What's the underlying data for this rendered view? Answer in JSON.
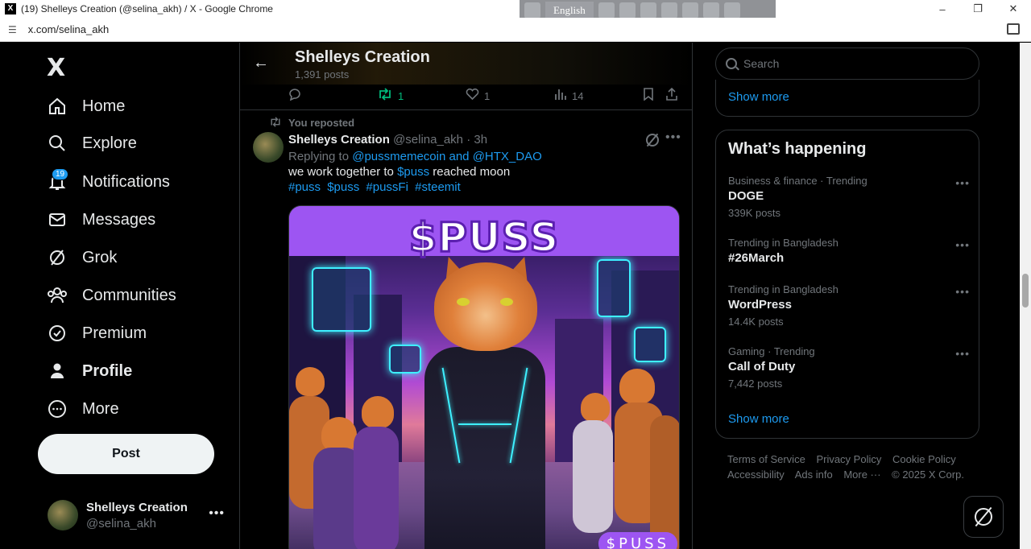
{
  "browser": {
    "window_title": "(19) Shelleys Creation (@selina_akh) / X - Google Chrome",
    "url": "x.com/selina_akh",
    "language_bar": "English",
    "favicon": "X"
  },
  "nav": {
    "logo": "X",
    "items": [
      {
        "label": "Home",
        "icon": "home-icon"
      },
      {
        "label": "Explore",
        "icon": "search-icon"
      },
      {
        "label": "Notifications",
        "icon": "bell-icon",
        "badge": "19"
      },
      {
        "label": "Messages",
        "icon": "envelope-icon"
      },
      {
        "label": "Grok",
        "icon": "grok-icon"
      },
      {
        "label": "Communities",
        "icon": "people-icon"
      },
      {
        "label": "Premium",
        "icon": "verified-icon"
      },
      {
        "label": "Profile",
        "icon": "person-icon"
      },
      {
        "label": "More",
        "icon": "more-circle-icon"
      }
    ],
    "post_button": "Post",
    "account": {
      "name": "Shelleys Creation",
      "handle": "@selina_akh"
    }
  },
  "profile_header": {
    "title": "Shelleys Creation",
    "posts_count": "1,391 posts"
  },
  "prev_actions": {
    "reply_count": "",
    "repost_count": "1",
    "like_count": "1",
    "views_count": "14"
  },
  "tweet": {
    "social_context": "You reposted",
    "author_name": "Shelleys Creation",
    "author_handle": "@selina_akh",
    "separator": "·",
    "time": "3h",
    "replying_prefix": "Replying to",
    "replying_user1": "@pussmemecoin",
    "replying_and": "and",
    "replying_user2": "@HTX_DAO",
    "text_before": "we work together to",
    "text_cashtag": "$puss",
    "text_after": "reached moon",
    "hashtags": [
      "#puss",
      "$puss",
      "#pussFi",
      "#steemit"
    ],
    "media_title": "$PUSS",
    "media_watermark": "$PUSS"
  },
  "right": {
    "search_placeholder": "Search",
    "show_more_1": "Show more",
    "whats_happening": "What’s happening",
    "trends": [
      {
        "context": "Business & finance · Trending",
        "title": "DOGE",
        "count": "339K posts"
      },
      {
        "context": "Trending in Bangladesh",
        "title": "#26March",
        "count": ""
      },
      {
        "context": "Trending in Bangladesh",
        "title": "WordPress",
        "count": "14.4K posts"
      },
      {
        "context": "Gaming · Trending",
        "title": "Call of Duty",
        "count": "7,442 posts"
      }
    ],
    "show_more_2": "Show more",
    "footer": [
      "Terms of Service",
      "Privacy Policy",
      "Cookie Policy",
      "Accessibility",
      "Ads info",
      "More ···",
      "© 2025 X Corp."
    ]
  },
  "colors": {
    "accent": "#1d9bf0",
    "background": "#000000",
    "repost_green": "#00ba7c",
    "media_purple": "#9d55f2"
  }
}
